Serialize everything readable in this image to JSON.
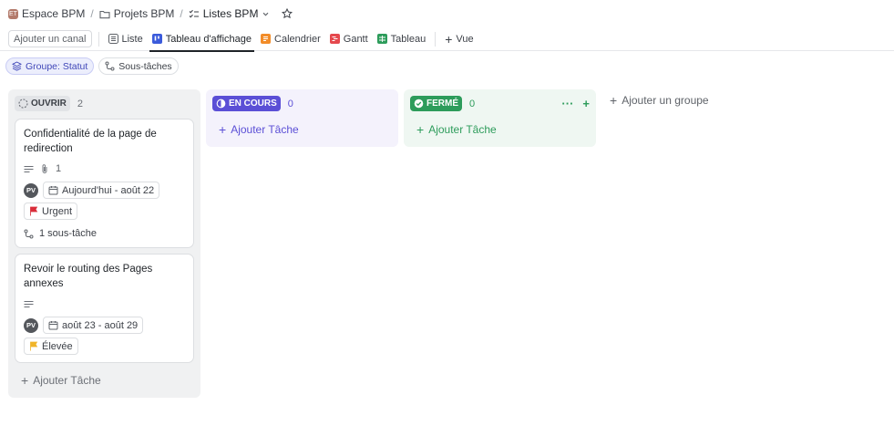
{
  "breadcrumb": {
    "space": "Espace BPM",
    "space_badge": "ET",
    "folder": "Projets BPM",
    "list": "Listes BPM"
  },
  "viewbar": {
    "add_channel": "Ajouter un canal",
    "tabs": [
      {
        "label": "Liste",
        "icon": "list-icon"
      },
      {
        "label": "Tableau d'affichage",
        "icon": "board-icon"
      },
      {
        "label": "Calendrier",
        "icon": "calendar-icon"
      },
      {
        "label": "Gantt",
        "icon": "gantt-icon"
      },
      {
        "label": "Tableau",
        "icon": "table-icon"
      }
    ],
    "add_view": "Vue"
  },
  "filters": {
    "group": "Groupe: Statut",
    "subtasks": "Sous-tâches"
  },
  "columns": {
    "open": {
      "status": "OUVRIR",
      "count": "2",
      "add_task": "Ajouter Tâche",
      "cards": [
        {
          "title": "Confidentialité de la page de redirection",
          "attachments": "1",
          "assignee": "PV",
          "dates": "Aujourd'hui - août 22",
          "priority": "Urgent",
          "subtasks": "1 sous-tâche"
        },
        {
          "title": "Revoir le routing des Pages annexes",
          "assignee": "PV",
          "dates": "août 23 - août 29",
          "priority": "Élevée"
        }
      ]
    },
    "in_progress": {
      "status": "EN COURS",
      "count": "0",
      "add_task": "Ajouter Tâche"
    },
    "closed": {
      "status": "FERMÉ",
      "count": "0",
      "add_task": "Ajouter Tâche"
    }
  },
  "add_group": "Ajouter un groupe",
  "colors": {
    "in_progress": "#5b4fd6",
    "closed": "#2d9c5b",
    "urgent_flag": "#d92d3a",
    "high_flag": "#f0b429"
  }
}
